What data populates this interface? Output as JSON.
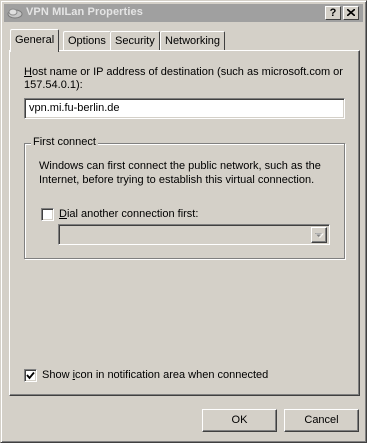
{
  "window": {
    "title": "VPN MILan Properties",
    "help_glyph": "?",
    "close_glyph": "✕"
  },
  "tabs": [
    {
      "label": "General",
      "active": true
    },
    {
      "label": "Options",
      "active": false
    },
    {
      "label": "Security",
      "active": false
    },
    {
      "label": "Networking",
      "active": false
    }
  ],
  "general": {
    "host_label_prefix": "H",
    "host_label_rest": "ost name or IP address of destination (such as microsoft.com or",
    "host_label_line2": "157.54.0.1):",
    "host_value": "vpn.mi.fu-berlin.de",
    "first_connect": {
      "legend": "First connect",
      "description_line1": "Windows can first connect the public network, such as the",
      "description_line2": "Internet, before trying to establish this virtual connection.",
      "dial_checkbox_prefix": "D",
      "dial_checkbox_rest": "ial another connection first:",
      "dial_checked": false,
      "connection_selected": ""
    },
    "show_icon_prefix": "Show ",
    "show_icon_mnemonic": "i",
    "show_icon_rest": "con in notification area when connected",
    "show_icon_checked": true
  },
  "footer": {
    "ok_label": "OK",
    "cancel_label": "Cancel"
  }
}
